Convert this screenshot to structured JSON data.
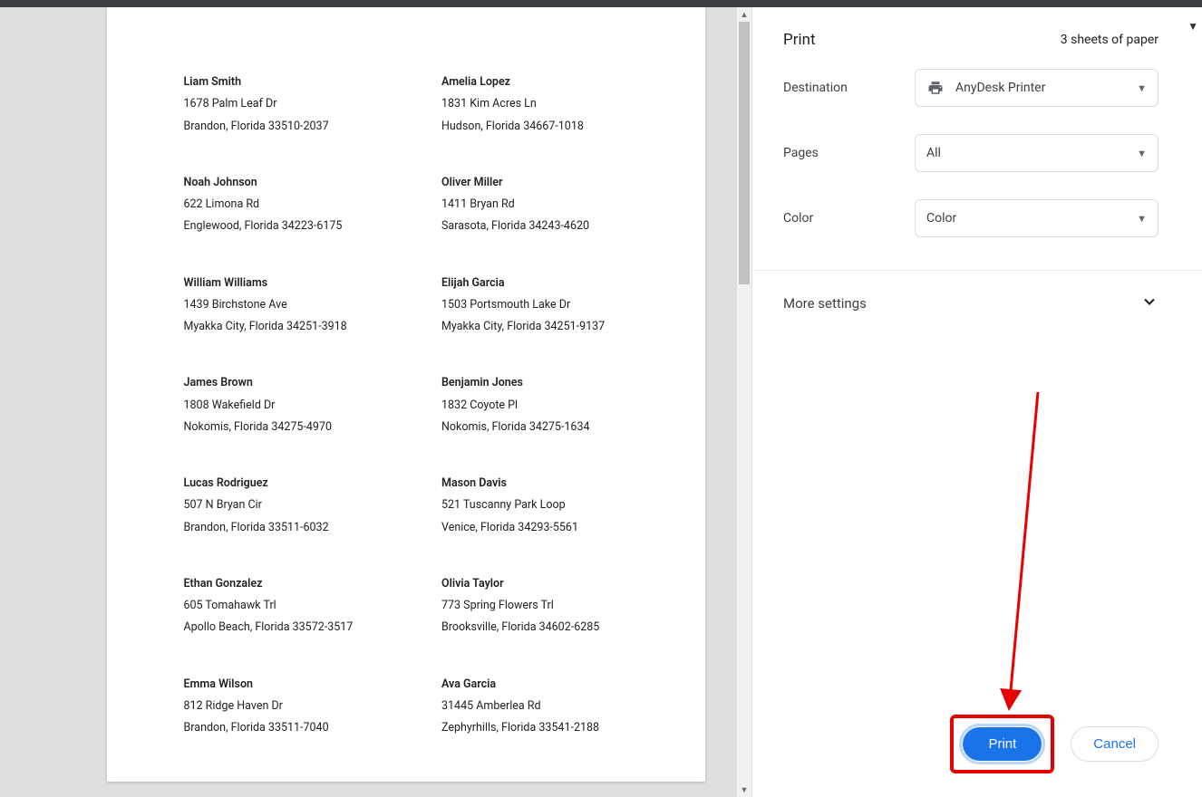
{
  "header": {
    "title": "Print",
    "sheets_info": "3 sheets of paper"
  },
  "settings": {
    "destination": {
      "label": "Destination",
      "value": "AnyDesk Printer"
    },
    "pages": {
      "label": "Pages",
      "value": "All"
    },
    "color": {
      "label": "Color",
      "value": "Color"
    }
  },
  "more_settings_label": "More settings",
  "buttons": {
    "print": "Print",
    "cancel": "Cancel"
  },
  "preview": {
    "left_col": [
      {
        "name": "Liam  Smith",
        "addr": "1678 Palm Leaf Dr",
        "city": "Brandon,  Florida  33510-2037"
      },
      {
        "name": "Noah  Johnson",
        "addr": "622 Limona Rd",
        "city": "Englewood,  Florida  34223-6175"
      },
      {
        "name": "William  Williams",
        "addr": "1439 Birchstone Ave",
        "city": "Myakka City,  Florida  34251-3918"
      },
      {
        "name": "James  Brown",
        "addr": "1808 Wakefield Dr",
        "city": "Nokomis,  Florida  34275-4970"
      },
      {
        "name": "Lucas  Rodriguez",
        "addr": "507 N Bryan Cir",
        "city": "Brandon,  Florida  33511-6032"
      },
      {
        "name": "Ethan  Gonzalez",
        "addr": "605 Tomahawk Trl",
        "city": "Apollo Beach,  Florida  33572-3517"
      },
      {
        "name": "Emma  Wilson",
        "addr": "812 Ridge Haven Dr",
        "city": "Brandon,  Florida  33511-7040"
      }
    ],
    "right_col": [
      {
        "name": "Amelia  Lopez",
        "addr": "1831 Kim Acres Ln",
        "city": "Hudson,  Florida  34667-1018"
      },
      {
        "name": "Oliver  Miller",
        "addr": "1411 Bryan Rd",
        "city": "Sarasota,  Florida  34243-4620"
      },
      {
        "name": "Elijah  Garcia",
        "addr": "1503 Portsmouth Lake Dr",
        "city": "Myakka City,  Florida  34251-9137"
      },
      {
        "name": "Benjamin  Jones",
        "addr": "1832 Coyote Pl",
        "city": "Nokomis,  Florida  34275-1634"
      },
      {
        "name": "Mason  Davis",
        "addr": "521 Tuscanny Park Loop",
        "city": "Venice,  Florida  34293-5561"
      },
      {
        "name": "Olivia  Taylor",
        "addr": "773 Spring Flowers Trl",
        "city": "Brooksville,  Florida  34602-6285"
      },
      {
        "name": "Ava  Garcia",
        "addr": "31445 Amberlea Rd",
        "city": "Zephyrhills,  Florida  33541-2188"
      }
    ]
  },
  "annotation": {
    "arrow_color": "#e60000"
  }
}
